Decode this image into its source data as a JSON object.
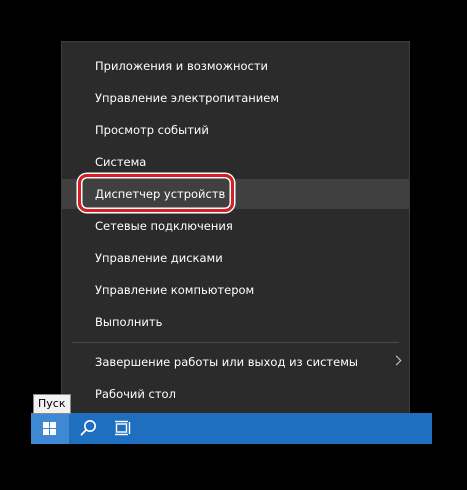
{
  "menu": {
    "items": [
      {
        "label": "Приложения и возможности"
      },
      {
        "label": "Управление электропитанием"
      },
      {
        "label": "Просмотр событий"
      },
      {
        "label": "Система"
      },
      {
        "label": "Диспетчер устройств"
      },
      {
        "label": "Сетевые подключения"
      },
      {
        "label": "Управление дисками"
      },
      {
        "label": "Управление компьютером"
      },
      {
        "label": "Выполнить"
      }
    ],
    "shutdown_label": "Завершение работы или выход из системы",
    "desktop_label": "Рабочий стол"
  },
  "tooltip": {
    "text": "Пуск"
  },
  "taskbar": {
    "icons": [
      "windows-start-icon",
      "search-icon",
      "task-view-icon"
    ]
  },
  "colors": {
    "menu_bg": "#2b2b2b",
    "hover_bg": "#404040",
    "taskbar": "#1f6fc1",
    "start_active": "#3e88d4",
    "highlight_ring": "#d81e24"
  }
}
